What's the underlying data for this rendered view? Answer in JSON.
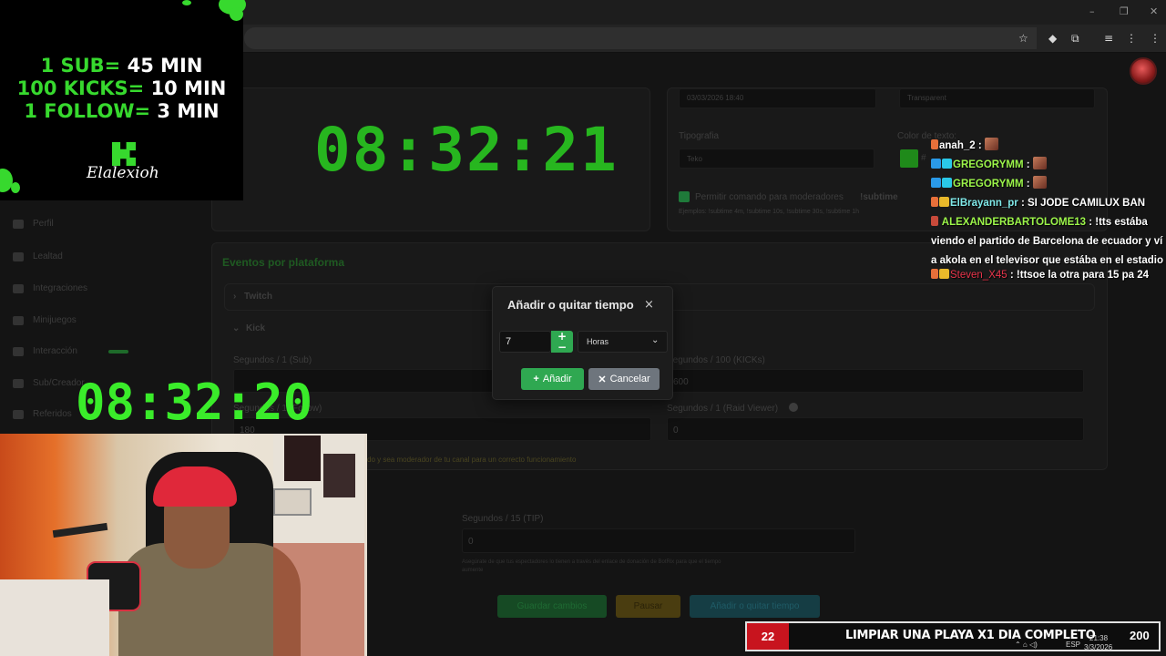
{
  "overlay": {
    "rates": [
      {
        "label": "1 SUB=",
        "value": "45 MIN"
      },
      {
        "label": "100 KICKS=",
        "value": "10 MIN"
      },
      {
        "label": "1 FOLLOW=",
        "value": "3 MIN"
      }
    ],
    "logo_text": "Elalexioh",
    "overlay_timer": "08:32:20",
    "accent_color": "#37d92e"
  },
  "page": {
    "main_timer": "08:32:21",
    "date_value": "03/03/2026 18:40",
    "transparent_value": "Transparent",
    "typography_label": "Tipografia",
    "typography_value": "Teko",
    "text_color_label": "Color de texto:",
    "text_color_value": "#",
    "mod_checkbox_label": "Permitir comando para moderadores",
    "mod_command": "!subtime",
    "mod_hint": "Ejemplos: !subtime 4m, !subtime 10s, !subtime 30s, !subtime 1h",
    "events_title": "Eventos por plataforma",
    "twitch_label": "Twitch",
    "kick_label": "Kick",
    "sub_label": "Segundos / 1 (Sub)",
    "kicks_label": "Segundos / 100 (KICKs)",
    "kicks_value": "600",
    "follow_label": "Segundos / 1 (Follow)",
    "follow_value": "180",
    "raid_label": "Segundos / 1 (Raid Viewer)",
    "raid_value": "0",
    "kick_note": "do y sea moderador de tu canal para un correcto funcionamiento",
    "tip_label": "Segundos / 15 (TIP)",
    "tip_value": "0",
    "tip_note": "Asegúrate de que tus espectadores lo tienen a través del enlace de donación de BotRix para que el tiempo",
    "tip_note_2": "aumente",
    "save_button": "Guardar cambios",
    "pause_button": "Pausar",
    "addtime_button": "Añadir o quitar tiempo"
  },
  "sidebar": {
    "items": [
      {
        "label": "Perfil"
      },
      {
        "label": "Lealtad"
      },
      {
        "label": "Integraciones"
      },
      {
        "label": "Minijuegos"
      },
      {
        "label": "Interacción"
      },
      {
        "label": "Sub/Creador"
      },
      {
        "label": "Referidos"
      }
    ]
  },
  "modal": {
    "title": "Añadir o quitar tiempo",
    "close_icon": "×",
    "amount_value": "7",
    "plus": "+",
    "minus": "−",
    "unit_value": "Horas",
    "add_button": "Añadir",
    "cancel_button": "Cancelar"
  },
  "chat": [
    {
      "user": "anah_2",
      "msg": "",
      "user_color": "#ffffff"
    },
    {
      "user": "GREGORYMM",
      "msg": "",
      "user_color": "#9cf54a"
    },
    {
      "user": "GREGORYMM",
      "msg": "",
      "user_color": "#9cf54a"
    },
    {
      "user": "ElBrayann_pr",
      "msg": "SI JODE CAMILUX BAN",
      "user_color": "#7fe8e8"
    },
    {
      "user": "ALEXANDERBARTOLOME13",
      "msg": "!tts estába viendo el partido de Barcelona de ecuador y ví a akola en el televisor que estába en el estadio",
      "user_color": "#9cf54a"
    },
    {
      "user": "Steven_X45",
      "msg": "!ttsoe la otra para 15 pa 24",
      "user_color": "#e8344a"
    }
  ],
  "goal": {
    "count": "22",
    "text": "LIMPIAR UNA PLAYA X1 DIA COMPLETO",
    "total": "200"
  },
  "taskbar": {
    "lang": "ESP",
    "time": "21:38",
    "date": "3/3/2026"
  }
}
